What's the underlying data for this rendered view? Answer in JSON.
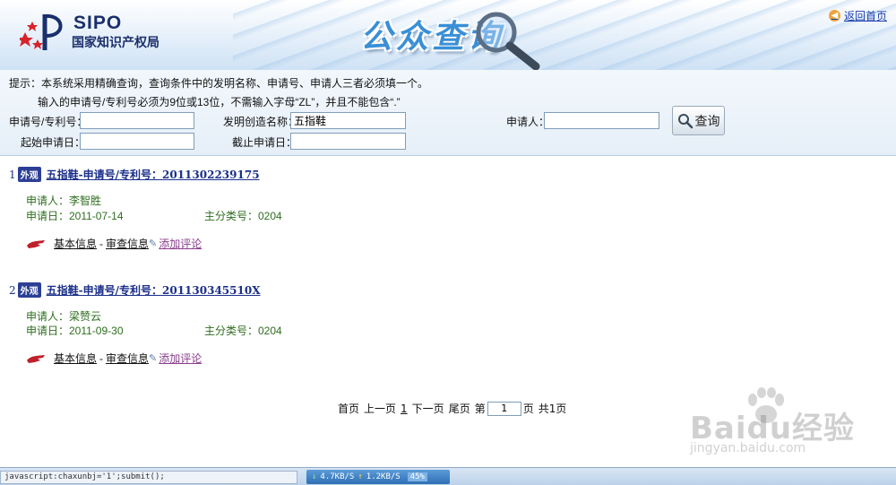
{
  "header": {
    "logo_text": "SIPO",
    "logo_subtitle": "国家知识产权局",
    "banner_title": "公众查询",
    "back_home": "返回首页"
  },
  "search": {
    "tip_line1": "提示：本系统采用精确查询，查询条件中的发明名称、申请号、申请人三者必须填一个。",
    "tip_line2": "输入的申请号/专利号必须为9位或13位，不需输入字母“ZL”，并且不能包含“.”",
    "app_number_label": "申请号/专利号：",
    "app_number_value": "",
    "invention_name_label": "发明创造名称：",
    "invention_name_value": "五指鞋",
    "applicant_label": "申请人：",
    "applicant_value": "",
    "start_date_label": "起始申请日：",
    "start_date_value": "",
    "end_date_label": "截止申请日：",
    "end_date_value": "",
    "search_button": "查询"
  },
  "results": [
    {
      "index": "1",
      "badge": "外观",
      "title": "五指鞋-申请号/专利号：2011302239175",
      "applicant": "申请人：李智胜",
      "app_date": "申请日：2011-07-14",
      "main_class": "主分类号：0204",
      "action_basic": "基本信息",
      "action_review": "审查信息",
      "action_comment": "添加评论"
    },
    {
      "index": "2",
      "badge": "外观",
      "title": "五指鞋-申请号/专利号：201130345510X",
      "applicant": "申请人：梁赞云",
      "app_date": "申请日：2011-09-30",
      "main_class": "主分类号：0204",
      "action_basic": "基本信息",
      "action_review": "审查信息",
      "action_comment": "添加评论"
    }
  ],
  "pager": {
    "first": "首页",
    "prev": "上一页",
    "current": "1",
    "next": "下一页",
    "last": "尾页",
    "goto_prefix": "第",
    "goto_value": "1",
    "goto_suffix": "页",
    "total": "共1页"
  },
  "watermark": {
    "main": "Baidu经验",
    "sub": "jingyan.baidu.com"
  },
  "statusbar": {
    "text": "javascript:chaxunbj='1';submit();",
    "down_speed": "4.7KB/S",
    "up_speed": "1.2KB/S",
    "percent": "45%"
  }
}
